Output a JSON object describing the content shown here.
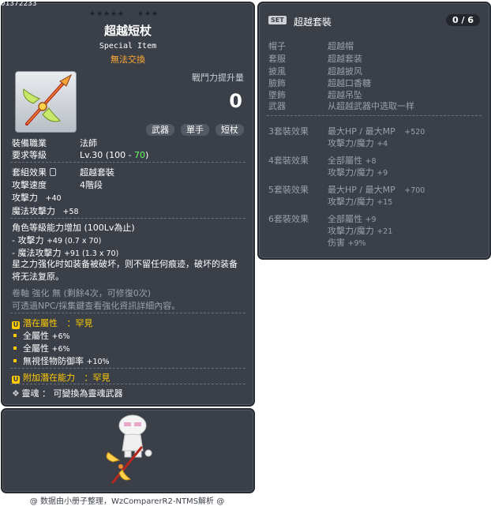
{
  "item": {
    "id": "01372233",
    "name": "超越短杖",
    "type": "Special Item",
    "trade_status": "無法交換",
    "attack_power_label": "戰鬥力提升量",
    "attack_power_value": "0",
    "tags": [
      "武器",
      "單手",
      "短杖"
    ],
    "job_label": "裝備職業",
    "job_value": "法師",
    "req_level_label": "要求等級",
    "req_level_value": "Lv.30",
    "req_level_paren_open": "(100",
    "req_level_paren_dash": " - ",
    "req_level_paren_bonus": "70",
    "req_level_paren_close": ")",
    "set_effect_label": "套組效果",
    "set_effect_value": "超越套裝",
    "attack_speed_label": "攻擊速度",
    "attack_speed_value": "4階段",
    "stats": [
      {
        "label": "攻擊力",
        "value": "+40"
      },
      {
        "label": "魔法攻擊力",
        "value": "+58"
      }
    ],
    "level_growth_title": "角色等級能力增加 (100Lv為止)",
    "level_growth": [
      {
        "label": "- 攻擊力",
        "value": "+49 (0.7 x 70)"
      },
      {
        "label": "- 魔法攻擊力",
        "value": "+91 (1.3 x 70)"
      }
    ],
    "description": "星之力强化时如装备被破坏，则不留任何痕迹，破坏的装备将无法复原。",
    "scroll_info": "卷軸 強化 無 (剩餘4次，可修復0次)",
    "star_info": "可透過NPC/採集鍵查看強化資訊詳細內容。",
    "potential_title": "潛在屬性",
    "potential_grade": "：罕見",
    "potentials": [
      {
        "label": "全屬性",
        "value": "+6%"
      },
      {
        "label": "全屬性",
        "value": "+6%"
      },
      {
        "label": "無視怪物防御率",
        "value": "+10%"
      }
    ],
    "bonus_potential_title": "附加潛在能力",
    "bonus_potential_grade": "：罕見",
    "soul_label": "靈魂",
    "soul_value": "： 可變換為靈魂武器"
  },
  "set": {
    "badge": "SET",
    "title": "超越套裝",
    "count": "0 / 6",
    "parts": [
      {
        "slot": "帽子",
        "name": "超越帽"
      },
      {
        "slot": "套服",
        "name": "超越套装"
      },
      {
        "slot": "披風",
        "name": "超越披风"
      },
      {
        "slot": "臉飾",
        "name": "超越口香糖"
      },
      {
        "slot": "墜飾",
        "name": "超越吊坠"
      },
      {
        "slot": "武器",
        "name": "从超越武器中选取一样"
      }
    ],
    "effects": [
      {
        "tier": "3套裝效果",
        "lines": [
          {
            "label": "最大HP / 最大MP",
            "value": "+520"
          },
          {
            "label": "攻擊力/魔力",
            "value": "+4"
          }
        ]
      },
      {
        "tier": "4套裝效果",
        "lines": [
          {
            "label": "全部屬性",
            "value": "+8"
          },
          {
            "label": "攻擊力/魔力",
            "value": "+9"
          }
        ]
      },
      {
        "tier": "5套裝效果",
        "lines": [
          {
            "label": "最大HP / 最大MP",
            "value": "+700"
          },
          {
            "label": "攻擊力/魔力",
            "value": "+15"
          }
        ]
      },
      {
        "tier": "6套裝效果",
        "lines": [
          {
            "label": "全部屬性",
            "value": "+9"
          },
          {
            "label": "攻擊力/魔力",
            "value": "+21"
          },
          {
            "label": "伤害",
            "value": "+9%"
          }
        ]
      }
    ]
  },
  "footer": {
    "credit": "@ 数据由小册子整理，WzComparerR2-NTMS解析 @"
  },
  "colors": {
    "panel_bg": "#3b3f48",
    "orange": "#ffaa33",
    "potential_gold": "#ffcc00",
    "green": "#66ff66"
  },
  "icons": [
    "item-star-icon",
    "staff-weapon-icon",
    "set-lock-icon",
    "potential-badge-icon",
    "soul-flame-icon",
    "character-avatar"
  ]
}
